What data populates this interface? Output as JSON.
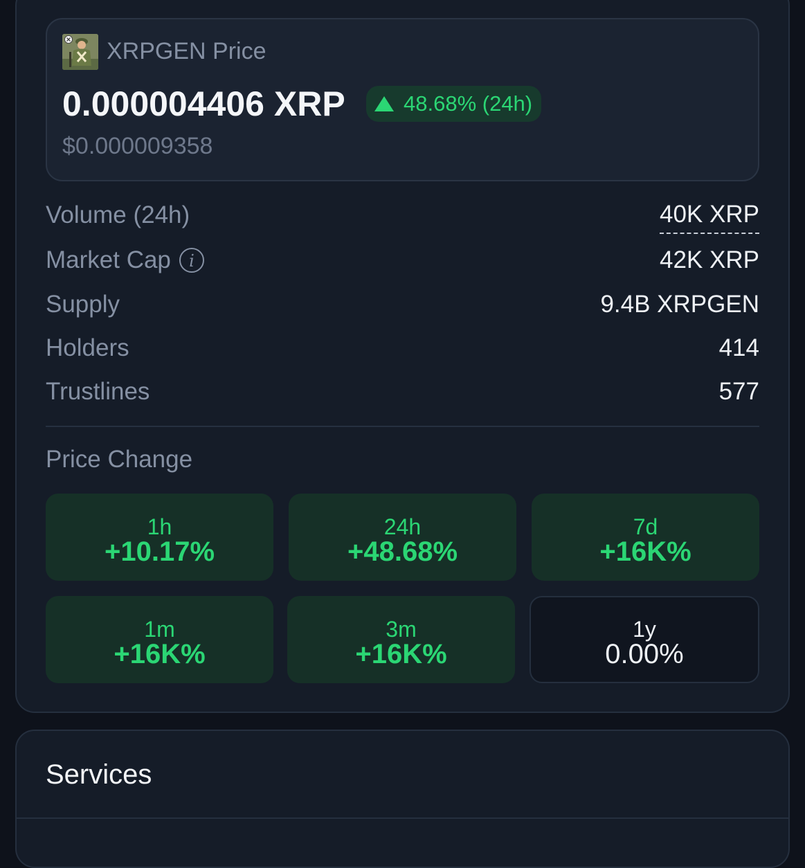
{
  "token": {
    "title": "XRPGEN Price",
    "price_xrp": "0.000004406 XRP",
    "change_24h": "48.68% (24h)",
    "price_usd": "$0.000009358",
    "avatar_icon": "soldier-avatar-icon"
  },
  "stats": [
    {
      "label": "Volume (24h)",
      "value": "40K XRP"
    },
    {
      "label": "Market Cap",
      "value": "42K XRP"
    },
    {
      "label": "Supply",
      "value": "9.4B XRPGEN"
    },
    {
      "label": "Holders",
      "value": "414"
    },
    {
      "label": "Trustlines",
      "value": "577"
    }
  ],
  "price_change": {
    "title": "Price Change",
    "tiles": [
      {
        "period": "1h",
        "pct": "+10.17%"
      },
      {
        "period": "24h",
        "pct": "+48.68%"
      },
      {
        "period": "7d",
        "pct": "+16K%"
      },
      {
        "period": "1m",
        "pct": "+16K%"
      },
      {
        "period": "3m",
        "pct": "+16K%"
      },
      {
        "period": "1y",
        "pct": "0.00%"
      }
    ]
  },
  "services": {
    "title": "Services"
  },
  "colors": {
    "positive": "#2bd674",
    "background": "#0e121b",
    "card": "#151c28"
  }
}
